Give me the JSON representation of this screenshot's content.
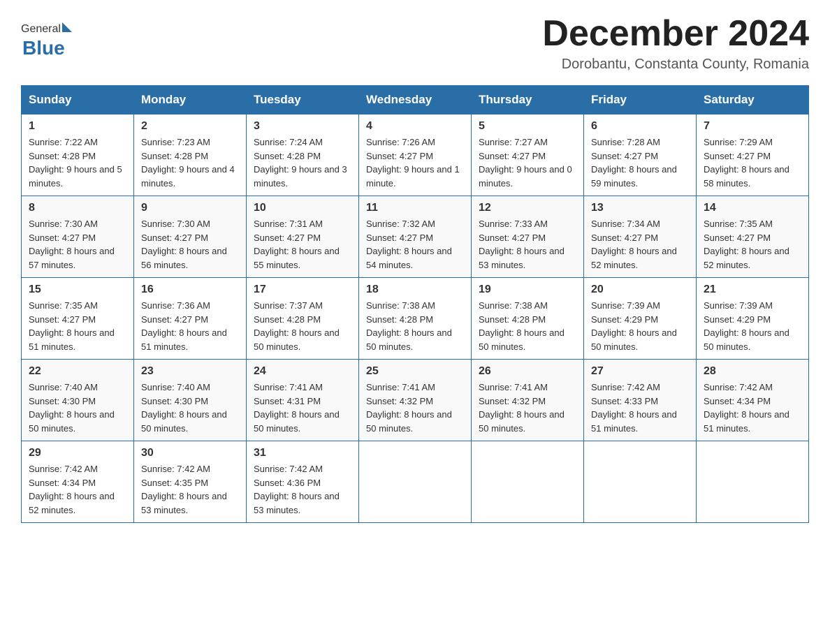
{
  "header": {
    "logo_general": "General",
    "logo_blue": "Blue",
    "month_title": "December 2024",
    "location": "Dorobantu, Constanta County, Romania"
  },
  "days_of_week": [
    "Sunday",
    "Monday",
    "Tuesday",
    "Wednesday",
    "Thursday",
    "Friday",
    "Saturday"
  ],
  "weeks": [
    [
      {
        "day": "1",
        "sunrise": "7:22 AM",
        "sunset": "4:28 PM",
        "daylight": "9 hours and 5 minutes."
      },
      {
        "day": "2",
        "sunrise": "7:23 AM",
        "sunset": "4:28 PM",
        "daylight": "9 hours and 4 minutes."
      },
      {
        "day": "3",
        "sunrise": "7:24 AM",
        "sunset": "4:28 PM",
        "daylight": "9 hours and 3 minutes."
      },
      {
        "day": "4",
        "sunrise": "7:26 AM",
        "sunset": "4:27 PM",
        "daylight": "9 hours and 1 minute."
      },
      {
        "day": "5",
        "sunrise": "7:27 AM",
        "sunset": "4:27 PM",
        "daylight": "9 hours and 0 minutes."
      },
      {
        "day": "6",
        "sunrise": "7:28 AM",
        "sunset": "4:27 PM",
        "daylight": "8 hours and 59 minutes."
      },
      {
        "day": "7",
        "sunrise": "7:29 AM",
        "sunset": "4:27 PM",
        "daylight": "8 hours and 58 minutes."
      }
    ],
    [
      {
        "day": "8",
        "sunrise": "7:30 AM",
        "sunset": "4:27 PM",
        "daylight": "8 hours and 57 minutes."
      },
      {
        "day": "9",
        "sunrise": "7:30 AM",
        "sunset": "4:27 PM",
        "daylight": "8 hours and 56 minutes."
      },
      {
        "day": "10",
        "sunrise": "7:31 AM",
        "sunset": "4:27 PM",
        "daylight": "8 hours and 55 minutes."
      },
      {
        "day": "11",
        "sunrise": "7:32 AM",
        "sunset": "4:27 PM",
        "daylight": "8 hours and 54 minutes."
      },
      {
        "day": "12",
        "sunrise": "7:33 AM",
        "sunset": "4:27 PM",
        "daylight": "8 hours and 53 minutes."
      },
      {
        "day": "13",
        "sunrise": "7:34 AM",
        "sunset": "4:27 PM",
        "daylight": "8 hours and 52 minutes."
      },
      {
        "day": "14",
        "sunrise": "7:35 AM",
        "sunset": "4:27 PM",
        "daylight": "8 hours and 52 minutes."
      }
    ],
    [
      {
        "day": "15",
        "sunrise": "7:35 AM",
        "sunset": "4:27 PM",
        "daylight": "8 hours and 51 minutes."
      },
      {
        "day": "16",
        "sunrise": "7:36 AM",
        "sunset": "4:27 PM",
        "daylight": "8 hours and 51 minutes."
      },
      {
        "day": "17",
        "sunrise": "7:37 AM",
        "sunset": "4:28 PM",
        "daylight": "8 hours and 50 minutes."
      },
      {
        "day": "18",
        "sunrise": "7:38 AM",
        "sunset": "4:28 PM",
        "daylight": "8 hours and 50 minutes."
      },
      {
        "day": "19",
        "sunrise": "7:38 AM",
        "sunset": "4:28 PM",
        "daylight": "8 hours and 50 minutes."
      },
      {
        "day": "20",
        "sunrise": "7:39 AM",
        "sunset": "4:29 PM",
        "daylight": "8 hours and 50 minutes."
      },
      {
        "day": "21",
        "sunrise": "7:39 AM",
        "sunset": "4:29 PM",
        "daylight": "8 hours and 50 minutes."
      }
    ],
    [
      {
        "day": "22",
        "sunrise": "7:40 AM",
        "sunset": "4:30 PM",
        "daylight": "8 hours and 50 minutes."
      },
      {
        "day": "23",
        "sunrise": "7:40 AM",
        "sunset": "4:30 PM",
        "daylight": "8 hours and 50 minutes."
      },
      {
        "day": "24",
        "sunrise": "7:41 AM",
        "sunset": "4:31 PM",
        "daylight": "8 hours and 50 minutes."
      },
      {
        "day": "25",
        "sunrise": "7:41 AM",
        "sunset": "4:32 PM",
        "daylight": "8 hours and 50 minutes."
      },
      {
        "day": "26",
        "sunrise": "7:41 AM",
        "sunset": "4:32 PM",
        "daylight": "8 hours and 50 minutes."
      },
      {
        "day": "27",
        "sunrise": "7:42 AM",
        "sunset": "4:33 PM",
        "daylight": "8 hours and 51 minutes."
      },
      {
        "day": "28",
        "sunrise": "7:42 AM",
        "sunset": "4:34 PM",
        "daylight": "8 hours and 51 minutes."
      }
    ],
    [
      {
        "day": "29",
        "sunrise": "7:42 AM",
        "sunset": "4:34 PM",
        "daylight": "8 hours and 52 minutes."
      },
      {
        "day": "30",
        "sunrise": "7:42 AM",
        "sunset": "4:35 PM",
        "daylight": "8 hours and 53 minutes."
      },
      {
        "day": "31",
        "sunrise": "7:42 AM",
        "sunset": "4:36 PM",
        "daylight": "8 hours and 53 minutes."
      },
      null,
      null,
      null,
      null
    ]
  ],
  "labels": {
    "sunrise": "Sunrise:",
    "sunset": "Sunset:",
    "daylight": "Daylight:"
  }
}
